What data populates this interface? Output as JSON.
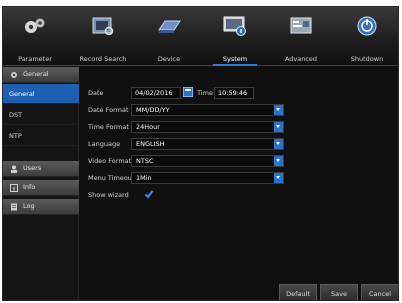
{
  "nav": {
    "items": [
      {
        "label": "Parameter",
        "icon": "gears-icon"
      },
      {
        "label": "Record Search",
        "icon": "record-search-icon"
      },
      {
        "label": "Device",
        "icon": "hard-drive-icon"
      },
      {
        "label": "System",
        "icon": "system-monitor-icon",
        "active": true
      },
      {
        "label": "Advanced",
        "icon": "advanced-icon"
      },
      {
        "label": "Shutdown",
        "icon": "power-icon"
      }
    ]
  },
  "sidebar": {
    "general_header": "General",
    "general_items": [
      "General",
      "DST",
      "NTP"
    ],
    "users_header": "Users",
    "info_header": "Info",
    "log_header": "Log"
  },
  "form": {
    "date_label": "Date",
    "date_value": "04/02/2016",
    "time_label": "Time",
    "time_value": "10:59:46",
    "date_format_label": "Date Format",
    "date_format_value": "MM/DD/YY",
    "time_format_label": "Time Format",
    "time_format_value": "24Hour",
    "language_label": "Language",
    "language_value": "ENGLISH",
    "video_format_label": "Video Format",
    "video_format_value": "NTSC",
    "menu_timeouts_label": "Menu Timeouts",
    "menu_timeouts_value": "1Min",
    "show_wizard_label": "Show wizard",
    "show_wizard_checked": true
  },
  "buttons": {
    "default": "Default",
    "save": "Save",
    "cancel": "Cancel"
  },
  "colors": {
    "accent": "#2a73c9",
    "active_row": "#1d5fb3",
    "background": "#101010"
  }
}
